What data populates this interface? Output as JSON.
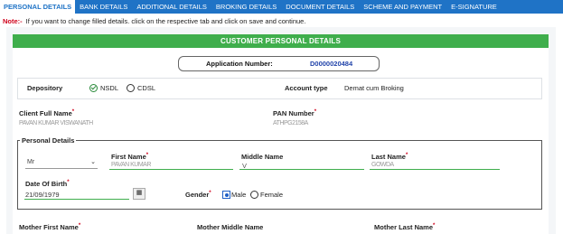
{
  "tabs": [
    {
      "label": "PERSONAL DETAILS",
      "active": true
    },
    {
      "label": "BANK DETAILS",
      "active": false
    },
    {
      "label": "ADDITIONAL DETAILS",
      "active": false
    },
    {
      "label": "BROKING DETAILS",
      "active": false
    },
    {
      "label": "DOCUMENT DETAILS",
      "active": false
    },
    {
      "label": "SCHEME AND PAYMENT",
      "active": false
    },
    {
      "label": "E-SIGNATURE",
      "active": false
    }
  ],
  "note": {
    "label": "Note:-",
    "text": "If you want to change filled details. click on the respective tab and click on save and continue."
  },
  "section_title": "CUSTOMER PERSONAL DETAILS",
  "application": {
    "label": "Application Number:",
    "value": "D0000020484"
  },
  "depository": {
    "label": "Depository",
    "options": [
      "NSDL",
      "CDSL"
    ],
    "selected": "NSDL"
  },
  "account_type": {
    "label": "Account type",
    "value": "Demat cum Broking"
  },
  "client_name": {
    "label": "Client Full Name",
    "value": "PAVAN KUMAR VISWANATH"
  },
  "pan": {
    "label": "PAN Number",
    "value": "ATHPG2158A"
  },
  "personal": {
    "legend": "Personal Details",
    "title_select": "Mr",
    "first_name": {
      "label": "First Name",
      "value": "PAVAN KUMAR"
    },
    "middle_name": {
      "label": "Middle Name",
      "value": "V"
    },
    "last_name": {
      "label": "Last Name",
      "value": "GOWDA"
    },
    "dob": {
      "label": "Date Of Birth",
      "value": "21/09/1979"
    },
    "gender": {
      "label": "Gender",
      "options": [
        "Male",
        "Female"
      ],
      "selected": "Male"
    }
  },
  "mother": {
    "first": "Mother First Name",
    "middle": "Mother Middle Name",
    "last": "Mother Last Name"
  },
  "colors": {
    "tabbar": "#1f73c6",
    "accent": "#3fae4c",
    "app_number": "#2244aa",
    "required": "#d0021b"
  }
}
